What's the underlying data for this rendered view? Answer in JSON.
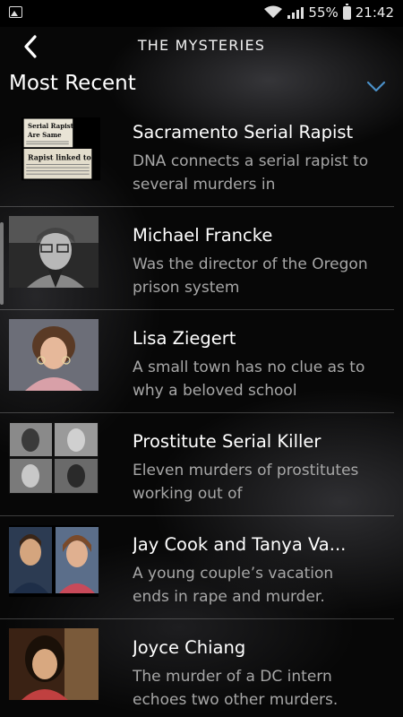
{
  "status_bar": {
    "battery_pct": "55%",
    "time": "21:42"
  },
  "header": {
    "title": "THE MYSTERIES"
  },
  "section": {
    "title": "Most Recent"
  },
  "items": [
    {
      "title": "Sacramento Serial Rapist",
      "description": "DNA connects a serial rapist to several murders in",
      "thumb_text": {
        "headline1": "Serial Rapist\nAre Same",
        "headline2": "Rapist linked to"
      }
    },
    {
      "title": "Michael Francke",
      "description": "Was the director of the Oregon prison system"
    },
    {
      "title": "Lisa Ziegert",
      "description": "A small town has no clue as to why a beloved school"
    },
    {
      "title": "Prostitute Serial Killer",
      "description": "Eleven murders of prostitutes working out of"
    },
    {
      "title": "Jay Cook and Tanya Va...",
      "description": "A young couple’s vacation ends in rape and murder."
    },
    {
      "title": "Joyce Chiang",
      "description": "The murder of a DC intern echoes two other murders."
    }
  ],
  "icons": {
    "back": "chevron-left-icon",
    "toggle": "chevron-down-icon",
    "accent": "#4a90c8"
  }
}
